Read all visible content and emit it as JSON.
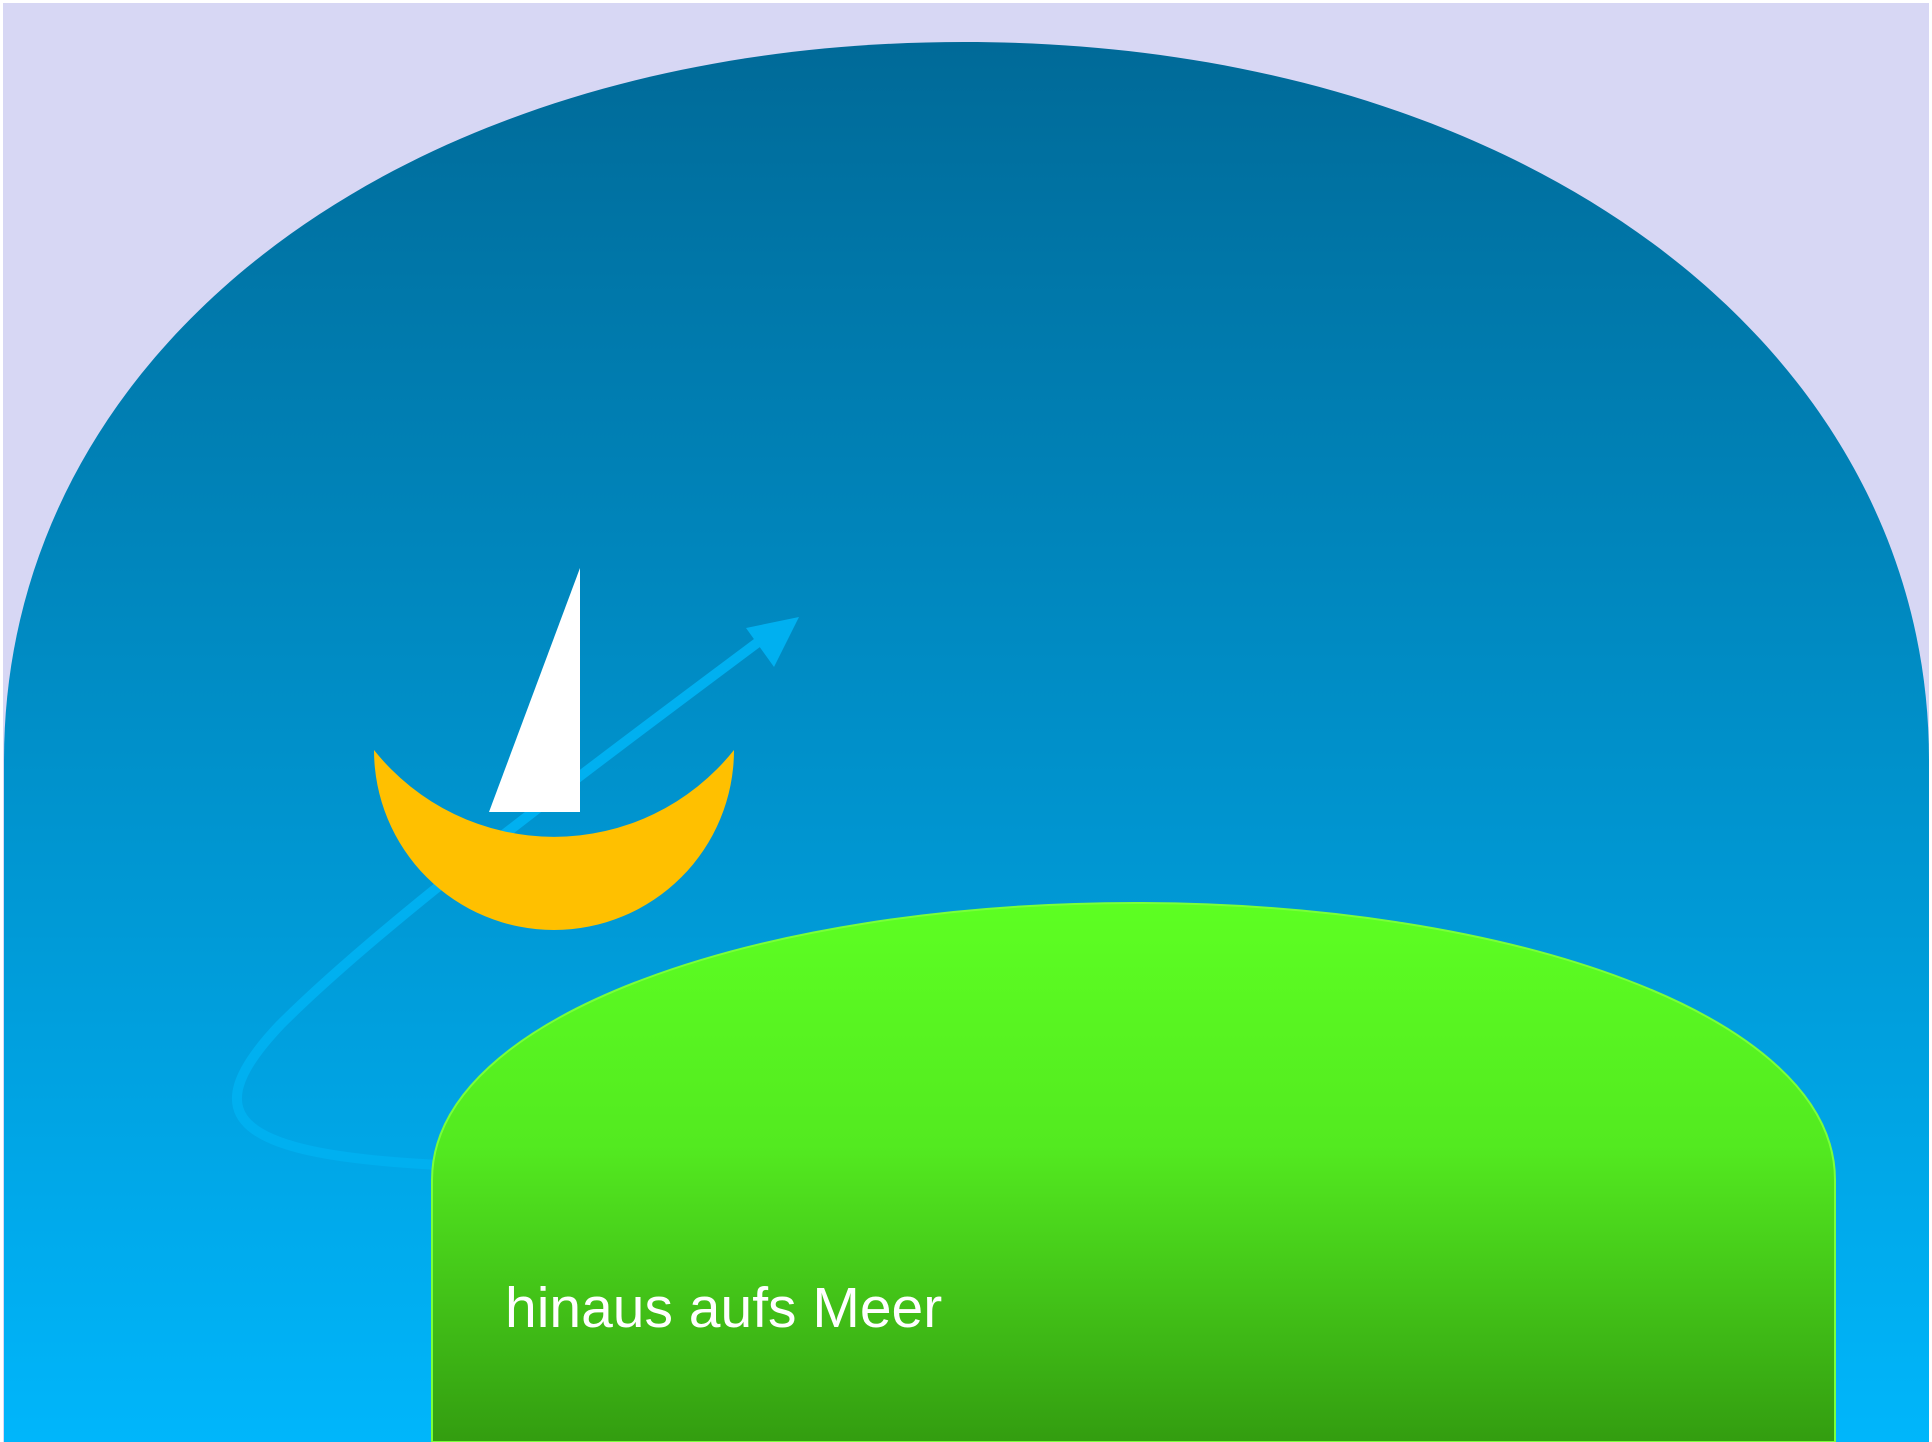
{
  "slide": {
    "caption": "hinaus aufs Meer"
  },
  "colors": {
    "backdrop": "#d7d7f4",
    "sea_top": "#006a98",
    "sea_bottom": "#00b6fb",
    "hill_top": "#5dff22",
    "hill_bottom": "#339d10",
    "hill_edge": "#79ff3a",
    "boat_hull": "#ffc000",
    "sail": "#ffffff",
    "route_arrow": "#00b0f0",
    "caption_text": "#ffffff"
  },
  "icons": {
    "boat": "sailboat-icon",
    "route": "curved-arrow-icon"
  }
}
